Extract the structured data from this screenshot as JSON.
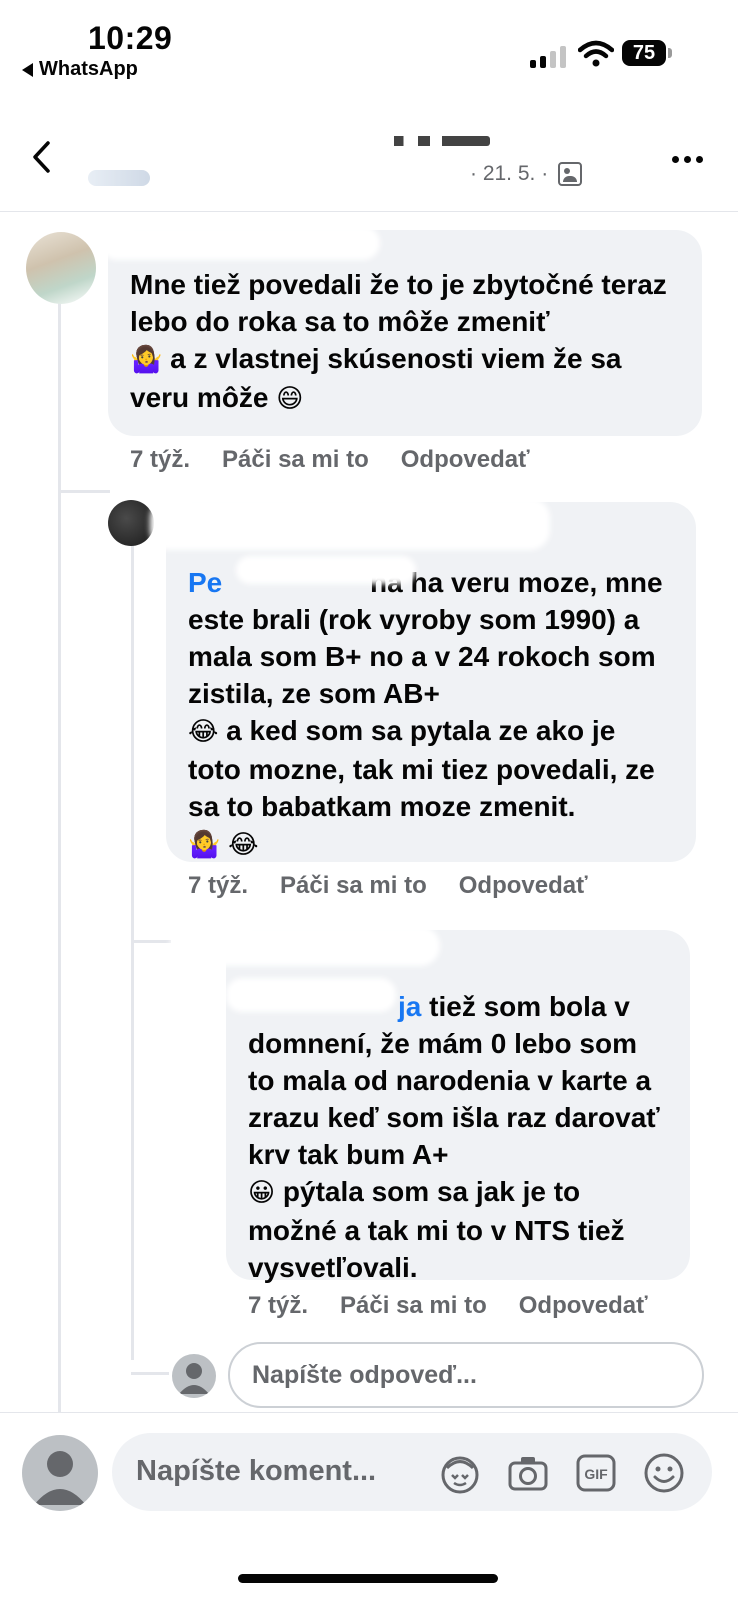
{
  "status_bar": {
    "time": "10:29",
    "back_app": "WhatsApp",
    "battery": "75"
  },
  "header": {
    "meta_date": "· 21. 5. ·"
  },
  "comments": [
    {
      "text": "Mne tiež povedali že to je zbytočné teraz lebo do roka sa to môže zmeniť",
      "text_cont": "a z vlastnej skúsenosti viem že sa veru môže",
      "emoji_1": "🤷‍♀️",
      "emoji_2": "😄",
      "time": "7 týž.",
      "like": "Páči sa mi to",
      "reply": "Odpovedať"
    },
    {
      "mention": "Pe",
      "text": "ha ha veru moze, mne este brali (rok vyroby som 1990) a mala som B+ no a v 24 rokoch som zistila, ze som AB+",
      "text_cont": "a ked som sa pytala ze ako je toto mozne, tak mi tiez povedali, ze sa to babatkam moze zmenit.",
      "emoji_1": "😂",
      "emoji_2": "🤷‍♀️",
      "emoji_3": "😂",
      "time": "7 týž.",
      "like": "Páči sa mi to",
      "reply": "Odpovedať"
    },
    {
      "mention": "ја",
      "text": "tiež som bola v domnení, že mám 0 lebo som to mala od narodenia v karte a zrazu keď som išla raz darovať krv tak bum A+",
      "text_cont": "pýtala som sa jak je to možné a tak mi to v NTS tiež vysvetľovali.",
      "emoji_1": "😀",
      "time": "7 týž.",
      "like": "Páči sa mi to",
      "reply": "Odpovedať"
    }
  ],
  "reply_input": {
    "placeholder": "Napíšte odpoveď..."
  },
  "composer": {
    "placeholder": "Napíšte koment...",
    "icons": [
      "avatar-sticker-icon",
      "camera-icon",
      "gif-icon",
      "emoji-icon"
    ]
  }
}
